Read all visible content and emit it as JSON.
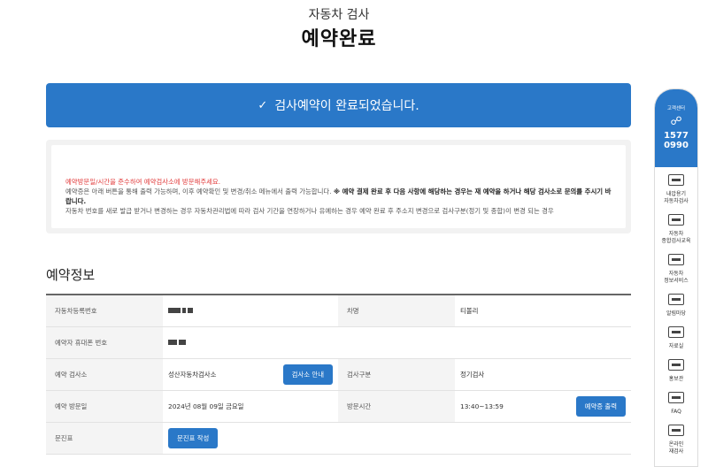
{
  "page": {
    "subtitle": "자동차 검사",
    "title": "예약완료"
  },
  "banner": {
    "icon": "check-icon",
    "text": "검사예약이 완료되었습니다."
  },
  "notice": {
    "warning": "예약방문일/시간을 준수하여 예약검사소에 방문해주세요.",
    "line2_normal": "예약증은 아래 버튼을 통해 출력 가능하며, 이후 예약확인 및 변경/취소 메뉴에서 출력 가능합니다. ",
    "line2_bold": "※ 예약 결제 완료 후 다음 사항에 해당하는 경우는 재 예약을 하거나 해당 검사소로 문의를 주시기 바랍니다.",
    "line3": "자동차 번호를 새로 발급 받거나 변경하는 경우 자동차관리법에 따라 검사 기간을 연장하거나 유예하는 경우 예약 완료 후 주소지 변경으로 검사구분(정기 및 종합)이 변경 되는 경우"
  },
  "reservation": {
    "section_title": "예약정보",
    "labels": {
      "car_number": "자동차등록번호",
      "car_name": "차명",
      "phone": "예약자 휴대폰 번호",
      "center": "예약 검사소",
      "inspection_type": "검사구분",
      "visit_date": "예약 방문일",
      "visit_time": "방문시간",
      "questionnaire": "문진표"
    },
    "values": {
      "car_name": "티볼리",
      "center": "성산자동차검사소",
      "inspection_type": "정기검사",
      "visit_date": "2024년 08월 09일 금요일",
      "visit_time": "13:40~13:59"
    },
    "buttons": {
      "center_info": "검사소 안내",
      "print": "예약증 출력",
      "questionnaire": "문진표 작성"
    }
  },
  "quickmenu": {
    "cc_label": "고객센터",
    "cc_icon": "headset-icon",
    "cc_number_1": "1577",
    "cc_number_2": "0990",
    "items": [
      {
        "label": "내압용기\n자동차검사",
        "icon": "car-icon"
      },
      {
        "label": "자동차\n종합검사교육",
        "icon": "car-icon"
      },
      {
        "label": "자동차\n정보서비스",
        "icon": "car-icon"
      },
      {
        "label": "알림마당",
        "icon": "car-icon"
      },
      {
        "label": "자료실",
        "icon": "document-icon"
      },
      {
        "label": "홍보관",
        "icon": "megaphone-icon"
      },
      {
        "label": "FAQ",
        "icon": "faq-icon"
      },
      {
        "label": "온라인\n재검사",
        "icon": "car-icon"
      }
    ]
  },
  "colors": {
    "primary": "#2a78c8",
    "warning": "#e23c3c"
  }
}
